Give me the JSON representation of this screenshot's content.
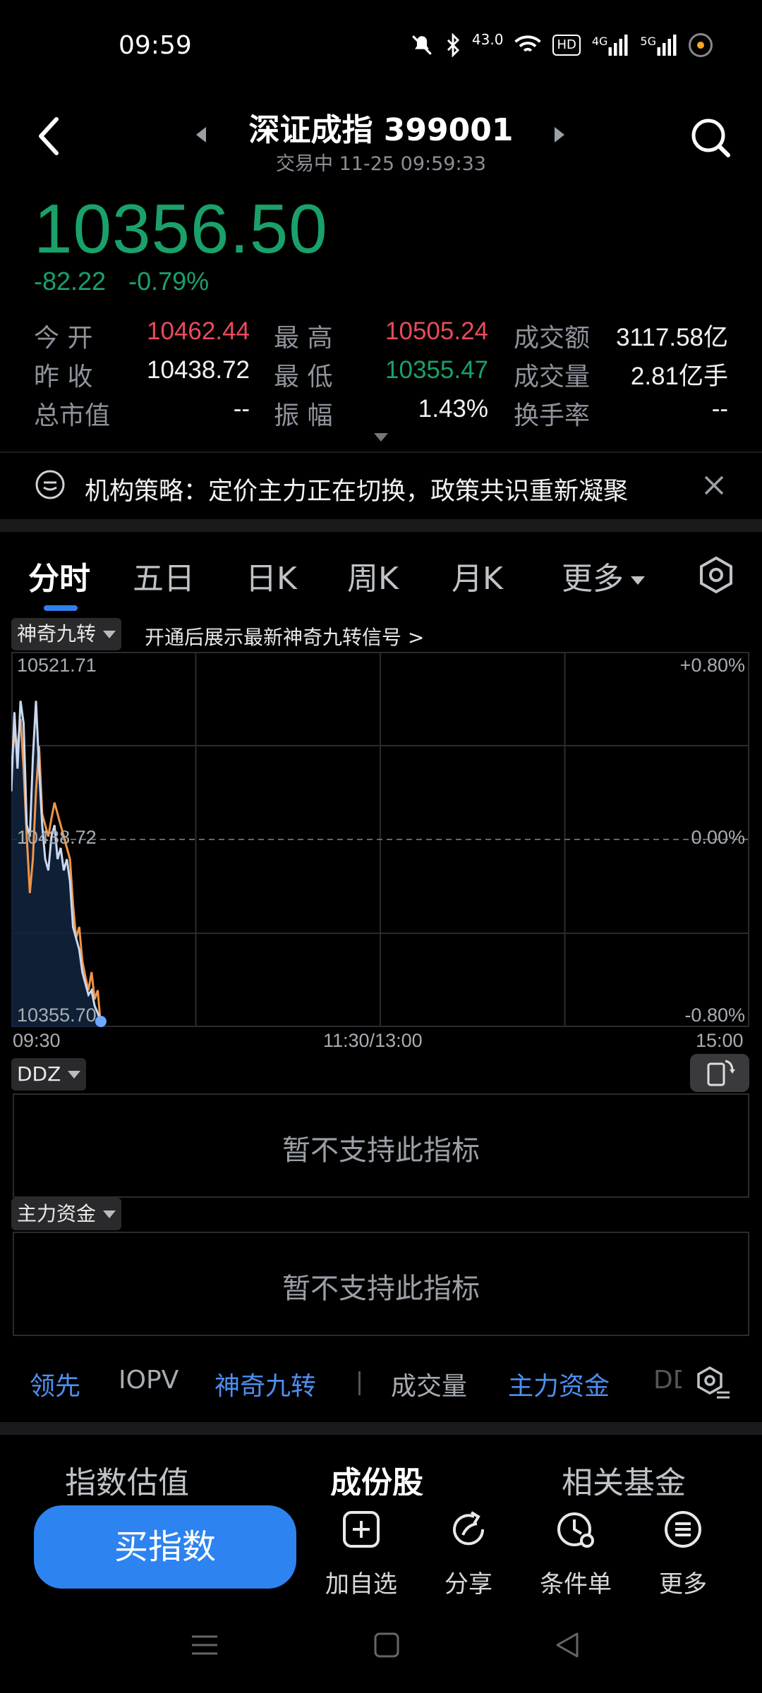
{
  "status_bar": {
    "time": "09:59",
    "speed": "43.0",
    "hd_badge": "HD",
    "net1": "4G",
    "net2": "5G"
  },
  "header": {
    "title": "深证成指 399001",
    "subtitle": "交易中 11-25 09:59:33"
  },
  "price": {
    "last": "10356.50",
    "change": "-82.22",
    "change_pct": "-0.79%"
  },
  "quote": {
    "open_label": "今 开",
    "open": "10462.44",
    "high_label": "最 高",
    "high": "10505.24",
    "amount_label": "成交额",
    "amount": "3117.58亿",
    "prev_close_label": "昨 收",
    "prev_close": "10438.72",
    "low_label": "最 低",
    "low": "10355.47",
    "volume_label": "成交量",
    "volume": "2.81亿手",
    "mcap_label": "总市值",
    "mcap": "--",
    "amplitude_label": "振 幅",
    "amplitude": "1.43%",
    "turnover_label": "换手率",
    "turnover": "--"
  },
  "banner": {
    "text": "机构策略：定价主力正在切换，政策共识重新凝聚"
  },
  "tabs": [
    "分时",
    "五日",
    "日K",
    "周K",
    "月K",
    "更多"
  ],
  "indicator_select": {
    "label": "神奇九转",
    "promo": "开通后展示最新神奇九转信号 >"
  },
  "chart_data": {
    "type": "line",
    "ylim": [
      10355.7,
      10521.71
    ],
    "y_labels": {
      "top": "10521.71",
      "mid": "10438.72",
      "bottom": "10355.70"
    },
    "pct_labels": {
      "top": "+0.80%",
      "mid": "0.00%",
      "bottom": "-0.80%"
    },
    "x_labels": [
      "09:30",
      "11:30/13:00",
      "15:00"
    ],
    "x": [
      0,
      1,
      2,
      3,
      4,
      5,
      6,
      7,
      8,
      9,
      10,
      11,
      12,
      13,
      14,
      15,
      16,
      17,
      18,
      19,
      20,
      21,
      22,
      23,
      24,
      25,
      26,
      27,
      28,
      29
    ],
    "x_total": 240,
    "series": [
      {
        "color": "#c9d8ef",
        "values": [
          10460,
          10495,
          10470,
          10500,
          10490,
          10445,
          10440,
          10475,
          10500,
          10470,
          10445,
          10430,
          10425,
          10440,
          10445,
          10430,
          10435,
          10425,
          10430,
          10420,
          10400,
          10395,
          10390,
          10380,
          10375,
          10370,
          10372,
          10365,
          10362,
          10358
        ]
      },
      {
        "color": "#f0954a",
        "values": [
          10470,
          10485,
          10480,
          10492,
          10470,
          10440,
          10415,
          10430,
          10460,
          10480,
          10450,
          10445,
          10440,
          10448,
          10455,
          10450,
          10445,
          10440,
          10435,
          10430,
          10410,
          10395,
          10400,
          10385,
          10378,
          10372,
          10380,
          10368,
          10372,
          10356
        ]
      }
    ]
  },
  "ddz": {
    "label": "DDZ",
    "empty_text": "暂不支持此指标"
  },
  "main_funds": {
    "label": "主力资金",
    "empty_text": "暂不支持此指标"
  },
  "indicator_strip": [
    "领先",
    "IOPV",
    "神奇九转",
    "成交量",
    "主力资金",
    "DD"
  ],
  "bottom_tabs": [
    "指数估值",
    "成份股",
    "相关基金"
  ],
  "actions": {
    "buy": "买指数",
    "add": "加自选",
    "share": "分享",
    "condition": "条件单",
    "more": "更多"
  }
}
